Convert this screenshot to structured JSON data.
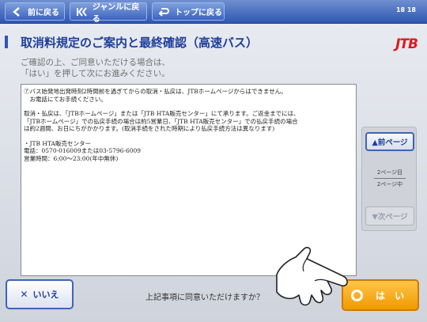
{
  "topbar": {
    "back_label": "前に戻る",
    "genre_label": "ジャンルに戻る",
    "top_label": "トップに戻る",
    "counter": "18 18"
  },
  "header": {
    "title": "取消料規定のご案内と最終確認（高速バス）",
    "subtitle_line1": "ご確認の上、ご同意いただける場合は、",
    "subtitle_line2": "「はい」を押して次にお進みください。",
    "logo": "JTB"
  },
  "content": {
    "lines": [
      "⑦バス始発地出発時刻2時間前を過ぎてからの取消・払戻は、JTBホームページからはできません。",
      "　お電話にてお手続ください。",
      "",
      "取消・払戻は、「JTBホームページ」または「JTB HTA販売センター」にて承ります。ご返金までには、",
      "「JTBホームページ」での払戻手続の場合は約5営業日、「JTB HTA販売センター」での払戻手続の場合",
      "は約2週間、お日にちがかかります。(取消手続をされた時期により払戻手続方法は異なります)",
      "",
      "・JTB HTA販売センター",
      "電話：0570-016009または03-5796-6009",
      "営業時間：6:00～23:00(年中無休)"
    ]
  },
  "pager": {
    "prev_label": "▲前ページ",
    "next_label": "▼次ページ",
    "page_current": "2ページ目",
    "page_total": "2ページ中"
  },
  "footer": {
    "no_label": "いいえ",
    "question": "上記事項に同意いただけますか？",
    "yes_label": "は　い"
  },
  "colors": {
    "accent": "#2f57b3",
    "title": "#1e3f9a",
    "yes": "#f5a100",
    "logo": "#d81c1c"
  }
}
